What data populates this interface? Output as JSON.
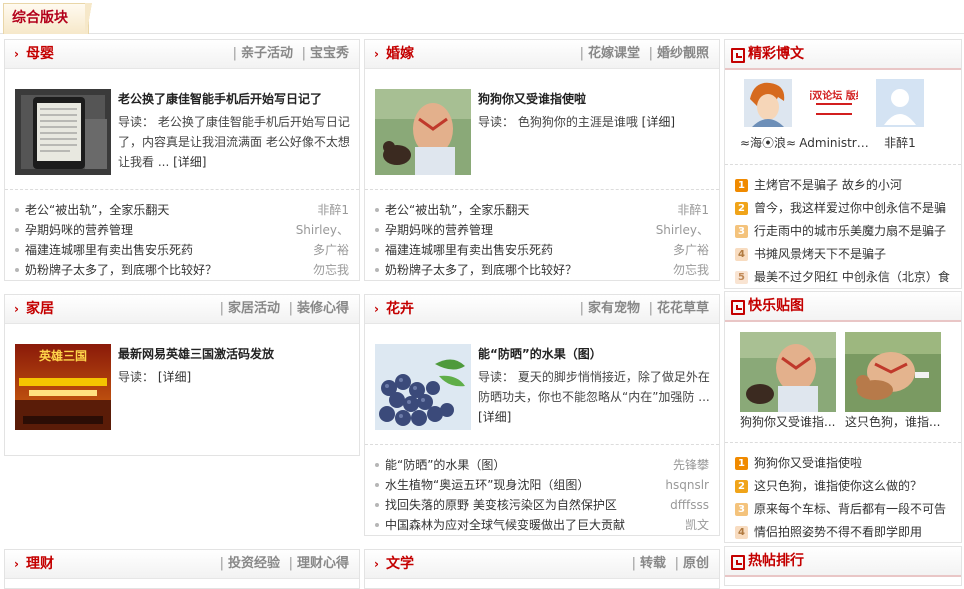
{
  "top": {
    "tab_label": "综合版块"
  },
  "panels": {
    "muying": {
      "title": "母婴",
      "links": [
        "亲子活动",
        "宝宝秀"
      ],
      "feature": {
        "title": "老公换了康佳智能手机后开始写日记了",
        "desc": "导读： 老公换了康佳智能手机后开始写日记了，内容真是让我泪流满面 老公好像不太想让我看 ...",
        "more": "[详细]"
      },
      "items": [
        {
          "text": "老公“被出轨”，全家乐翻天",
          "author": "非醉1"
        },
        {
          "text": "孕期妈咪的营养管理",
          "author": "Shirley、"
        },
        {
          "text": "福建连城哪里有卖出售安乐死药",
          "author": "多广裕"
        },
        {
          "text": "奶粉牌子太多了，到底哪个比较好？",
          "author": "勿忘我"
        }
      ]
    },
    "hunjia": {
      "title": "婚嫁",
      "links": [
        "花嫁课堂",
        "婚纱靓照"
      ],
      "feature": {
        "title": "狗狗你又受谁指使啦",
        "desc": "导读： 色狗狗你的主涯是谁哦",
        "more": "[详细]"
      },
      "items": [
        {
          "text": "老公“被出轨”，全家乐翻天",
          "author": "非醉1"
        },
        {
          "text": "孕期妈咪的营养管理",
          "author": "Shirley、"
        },
        {
          "text": "福建连城哪里有卖出售安乐死药",
          "author": "多广裕"
        },
        {
          "text": "奶粉牌子太多了，到底哪个比较好？",
          "author": "勿忘我"
        }
      ]
    },
    "jiaju": {
      "title": "家居",
      "links": [
        "家居活动",
        "装修心得"
      ],
      "feature": {
        "title": "最新网易英雄三国激活码发放",
        "desc": "导读：",
        "more": "[详细]",
        "image_text": "英雄三国"
      }
    },
    "huahui": {
      "title": "花卉",
      "links": [
        "家有宠物",
        "花花草草"
      ],
      "feature": {
        "title": "能“防晒”的水果（图）",
        "desc": "导读：                夏天的脚步悄悄接近，除了做足外在防晒功夫，你也不能忽略从“内在”加强防 ...",
        "more": "[详细]"
      },
      "items": [
        {
          "text": "能“防晒”的水果（图）",
          "author": "先锋攀"
        },
        {
          "text": "水生植物“奥运五环”现身沈阳（组图）",
          "author": "hsqnslr"
        },
        {
          "text": "找回失落的原野    美变核污染区为自然保护区",
          "author": "dfffsss"
        },
        {
          "text": "中国森林为应对全球气候变暖做出了巨大贡献",
          "author": "凯文"
        }
      ]
    },
    "licai": {
      "title": "理财",
      "links": [
        "投资经验",
        "理财心得"
      ]
    },
    "wenxue": {
      "title": "文学",
      "links": [
        "转载",
        "原创"
      ]
    }
  },
  "right": {
    "blog": {
      "title": "精彩博文",
      "users": [
        {
          "name": "≈海⦿浪≈"
        },
        {
          "name": "Administr…",
          "badge_text": "西双论坛 版纳"
        },
        {
          "name": "非醉1"
        }
      ],
      "ranks": [
        "主烤官不是骗子  故乡的小河",
        "曾今，我这样爱过你中创永信不是骗",
        "行走雨中的城市乐美魔力扇不是骗子",
        "书摊风景烤天下不是骗子",
        "最美不过夕阳红  中创永信（北京）食"
      ]
    },
    "photos": {
      "title": "快乐贴图",
      "thumbs": [
        {
          "caption": "狗狗你又受谁指..."
        },
        {
          "caption": "这只色狗，谁指..."
        }
      ],
      "ranks": [
        "狗狗你又受谁指使啦",
        "这只色狗，谁指使你这么做的？",
        "原来每个车标、背后都有一段不可告",
        "情侣拍照姿势不得不看即学即用"
      ]
    },
    "hot": {
      "title": "热帖排行"
    }
  }
}
